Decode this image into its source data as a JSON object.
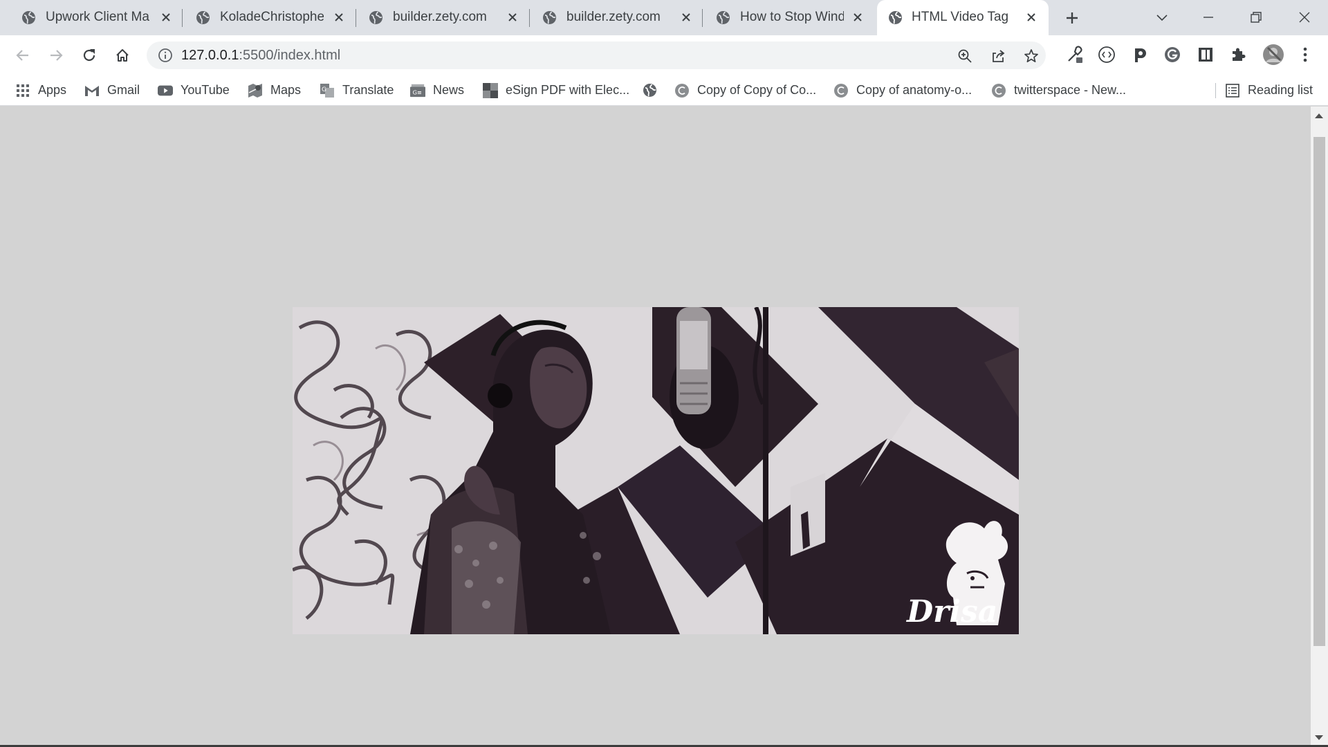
{
  "tabs": [
    {
      "title": "Upwork Client Mag",
      "active": false,
      "icon": "globe-icon"
    },
    {
      "title": "KoladeChristopher_",
      "active": false,
      "icon": "globe-icon"
    },
    {
      "title": "builder.zety.com",
      "active": false,
      "icon": "globe-icon"
    },
    {
      "title": "builder.zety.com",
      "active": false,
      "icon": "globe-icon"
    },
    {
      "title": "How to Stop Windo",
      "active": false,
      "icon": "globe-icon"
    },
    {
      "title": "HTML Video Tag",
      "active": true,
      "icon": "globe-icon"
    }
  ],
  "address_bar": {
    "host": "127.0.0.1",
    "path": ":5500/index.html"
  },
  "bookmarks": {
    "items": [
      {
        "label": "Apps",
        "icon": "apps-grid-icon"
      },
      {
        "label": "Gmail",
        "icon": "gmail-icon"
      },
      {
        "label": "YouTube",
        "icon": "youtube-icon"
      },
      {
        "label": "Maps",
        "icon": "maps-icon"
      },
      {
        "label": "Translate",
        "icon": "translate-icon"
      },
      {
        "label": "News",
        "icon": "news-icon"
      },
      {
        "label": "eSign PDF with Elec...",
        "icon": "esign-icon"
      },
      {
        "label": "",
        "icon": "globe-icon"
      },
      {
        "label": "Copy of Copy of Co...",
        "icon": "canva-icon"
      },
      {
        "label": "Copy of anatomy-o...",
        "icon": "canva-icon"
      },
      {
        "label": "twitterspace - New...",
        "icon": "canva-icon"
      }
    ],
    "reading_list": "Reading list"
  },
  "video": {
    "watermark": "Drisa"
  },
  "colors": {
    "page_background": "#d3d3d3",
    "tab_strip": "#dee1e6",
    "video_dark": "#2a1c26"
  }
}
